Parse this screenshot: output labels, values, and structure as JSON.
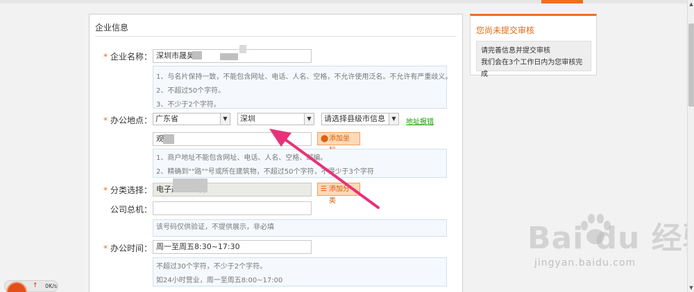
{
  "panel": {
    "title": "企业信息"
  },
  "form": {
    "company_name": {
      "required": "*",
      "label": "企业名称：",
      "value": "深圳市晟昊",
      "hints": [
        "1、与名片保持一致，不能包含网址、电话、人名、空格，不允许使用泛名。不允许有严重歧义。",
        "2、不超过50个字符。",
        "3、不少于2个字符。"
      ]
    },
    "office_location": {
      "required": "*",
      "label": "办公地点：",
      "province": "广东省",
      "city": "深圳",
      "district": "请选择县级市信息",
      "map_link": "地址报错",
      "address_value": "观",
      "add_coord_button": "添加坐标",
      "hints": [
        "1、商户地址不能包含网址、电话、人名、空格、邮编。",
        "2、精确到\"\"路\"\"号或所在建筑物，不超过50个字符，不得少于3个字符"
      ]
    },
    "category": {
      "required": "*",
      "label": "分类选择：",
      "value": "电子产",
      "value_suffix": "备",
      "add_category_button": "添加分类"
    },
    "phone": {
      "label": "公司总机：",
      "value": "",
      "hint": "该号码仅供验证，不提供展示，非必填"
    },
    "hours": {
      "required": "*",
      "label": "办公时间：",
      "value": "周一至周五8:30~17:30",
      "hints": [
        "不超过30个字符，不少于2个字符。",
        "如24小时营业，周一至周五8:00~17:00"
      ]
    }
  },
  "side": {
    "title": "您尚未提交审核",
    "lines": [
      "请完善信息并提交审核",
      "我们会在3个工作日内为您审核完成"
    ]
  },
  "watermark": {
    "brand": "Bai du 经验",
    "url": "jingyan.baidu.com"
  },
  "widget": {
    "speed": "0K/s"
  },
  "colors": {
    "accent": "#f06e1e",
    "link": "#1aa000",
    "arrow": "#e8317a",
    "hint_bg": "#f5f9fd"
  }
}
